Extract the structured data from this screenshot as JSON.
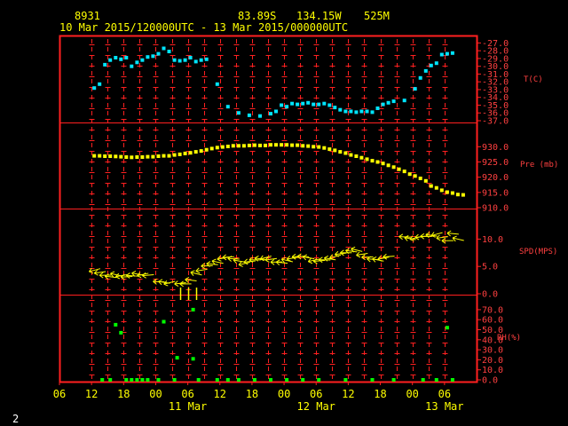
{
  "header": {
    "station_id": "8931",
    "lat": "83.89S",
    "lon": "134.15W",
    "elev": "525M",
    "time_range": "10 Mar 2015/120000UTC - 13 Mar 2015/000000UTC"
  },
  "page_number": "2",
  "colors": {
    "background": "#000000",
    "frame": "#ff2020",
    "panel_label": "#ff4040",
    "header_text": "#ffff00",
    "temperature": "#00e5ff",
    "pressure": "#ffff00",
    "wind": "#ffff00",
    "humidity": "#00ff00"
  },
  "chart_data": {
    "type": "scatter",
    "x_axis": {
      "unit": "hour",
      "range": [
        6,
        84
      ],
      "tick_labels": [
        "06",
        "12",
        "18",
        "00",
        "06",
        "12",
        "18",
        "00",
        "06",
        "12",
        "18",
        "00",
        "06"
      ],
      "day_labels": [
        {
          "label": "11 Mar",
          "hour": 30
        },
        {
          "label": "12 Mar",
          "hour": 54
        },
        {
          "label": "13 Mar",
          "hour": 78
        }
      ]
    },
    "panels": [
      {
        "key": "temperature",
        "label": "T(C)",
        "ylim": [
          -37,
          -26.5
        ],
        "ticks": [
          "-27.0",
          "-28.0",
          "-29.0",
          "-30.0",
          "-31.0",
          "-32.0",
          "-33.0",
          "-34.0",
          "-35.0",
          "-36.0",
          "-37.0"
        ],
        "tick_values": [
          -27,
          -28,
          -29,
          -30,
          -31,
          -32,
          -33,
          -34,
          -35,
          -36,
          -37
        ],
        "points": [
          [
            12.5,
            -32.8
          ],
          [
            13.5,
            -32.3
          ],
          [
            14.5,
            -29.8
          ],
          [
            15.5,
            -29.2
          ],
          [
            16.5,
            -28.9
          ],
          [
            17.5,
            -29.1
          ],
          [
            18.5,
            -28.9
          ],
          [
            19.5,
            -30.0
          ],
          [
            20.5,
            -29.5
          ],
          [
            21.5,
            -29.2
          ],
          [
            22.5,
            -28.8
          ],
          [
            23.5,
            -28.7
          ],
          [
            24.5,
            -28.4
          ],
          [
            25.5,
            -27.7
          ],
          [
            26.5,
            -28.1
          ],
          [
            27.5,
            -29.2
          ],
          [
            28.5,
            -29.3
          ],
          [
            29.5,
            -29.2
          ],
          [
            30.5,
            -28.9
          ],
          [
            31.5,
            -29.4
          ],
          [
            32.5,
            -29.2
          ],
          [
            33.5,
            -29.1
          ],
          [
            35.5,
            -32.3
          ],
          [
            37.5,
            -35.2
          ],
          [
            39.5,
            -36.0
          ],
          [
            41.5,
            -36.3
          ],
          [
            43.5,
            -36.4
          ],
          [
            45.5,
            -36.1
          ],
          [
            46.5,
            -35.8
          ],
          [
            47.5,
            -35.0
          ],
          [
            48.5,
            -35.2
          ],
          [
            49.5,
            -34.8
          ],
          [
            50.5,
            -34.9
          ],
          [
            51.5,
            -34.8
          ],
          [
            52.5,
            -34.7
          ],
          [
            53.5,
            -34.9
          ],
          [
            54.5,
            -34.9
          ],
          [
            55.5,
            -34.8
          ],
          [
            56.5,
            -35.0
          ],
          [
            57.5,
            -35.3
          ],
          [
            58.5,
            -35.6
          ],
          [
            59.5,
            -35.8
          ],
          [
            60.5,
            -35.8
          ],
          [
            61.5,
            -35.9
          ],
          [
            62.5,
            -35.8
          ],
          [
            63.5,
            -35.8
          ],
          [
            64.5,
            -35.9
          ],
          [
            65.5,
            -35.4
          ],
          [
            66.5,
            -34.9
          ],
          [
            67.5,
            -34.7
          ],
          [
            68.5,
            -34.5
          ],
          [
            70.5,
            -34.4
          ],
          [
            72.5,
            -32.9
          ],
          [
            73.5,
            -31.5
          ],
          [
            74.5,
            -30.6
          ],
          [
            75.5,
            -29.9
          ],
          [
            76.5,
            -29.6
          ],
          [
            77.5,
            -28.5
          ],
          [
            78.5,
            -28.4
          ],
          [
            79.5,
            -28.3
          ]
        ]
      },
      {
        "key": "pressure",
        "label": "Pre (mb)",
        "ylim": [
          910,
          933
        ],
        "ticks": [
          "930.0",
          "925.0",
          "920.0",
          "915.0",
          "910.0"
        ],
        "tick_values": [
          930,
          925,
          920,
          915,
          910
        ],
        "points": [
          [
            12.5,
            927.0
          ],
          [
            13.5,
            927.0
          ],
          [
            14.5,
            926.9
          ],
          [
            15.5,
            926.9
          ],
          [
            16.5,
            926.8
          ],
          [
            17.5,
            926.7
          ],
          [
            18.5,
            926.6
          ],
          [
            19.5,
            926.5
          ],
          [
            20.5,
            926.6
          ],
          [
            21.5,
            926.6
          ],
          [
            22.5,
            926.7
          ],
          [
            23.5,
            926.7
          ],
          [
            24.5,
            926.9
          ],
          [
            25.5,
            927.0
          ],
          [
            26.5,
            927.0
          ],
          [
            27.5,
            927.3
          ],
          [
            28.5,
            927.5
          ],
          [
            29.5,
            927.8
          ],
          [
            30.5,
            928.0
          ],
          [
            31.5,
            928.3
          ],
          [
            32.5,
            928.6
          ],
          [
            33.5,
            929.0
          ],
          [
            34.5,
            929.4
          ],
          [
            35.5,
            929.7
          ],
          [
            36.5,
            929.9
          ],
          [
            37.5,
            930.1
          ],
          [
            38.5,
            930.3
          ],
          [
            39.5,
            930.3
          ],
          [
            40.5,
            930.3
          ],
          [
            41.5,
            930.4
          ],
          [
            42.5,
            930.5
          ],
          [
            43.5,
            930.4
          ],
          [
            44.5,
            930.4
          ],
          [
            45.5,
            930.6
          ],
          [
            46.5,
            930.6
          ],
          [
            47.5,
            930.6
          ],
          [
            48.5,
            930.6
          ],
          [
            49.5,
            930.5
          ],
          [
            50.5,
            930.5
          ],
          [
            51.5,
            930.3
          ],
          [
            52.5,
            930.2
          ],
          [
            53.5,
            930.0
          ],
          [
            54.5,
            929.9
          ],
          [
            55.5,
            929.6
          ],
          [
            56.5,
            929.2
          ],
          [
            57.5,
            928.8
          ],
          [
            58.5,
            928.3
          ],
          [
            59.5,
            927.9
          ],
          [
            60.5,
            927.3
          ],
          [
            61.5,
            926.9
          ],
          [
            62.5,
            926.4
          ],
          [
            63.5,
            925.9
          ],
          [
            64.5,
            925.4
          ],
          [
            65.5,
            925.0
          ],
          [
            66.5,
            924.5
          ],
          [
            67.5,
            923.9
          ],
          [
            68.5,
            923.3
          ],
          [
            69.5,
            922.6
          ],
          [
            70.5,
            921.9
          ],
          [
            71.5,
            921.0
          ],
          [
            72.5,
            920.4
          ],
          [
            73.5,
            919.6
          ],
          [
            74.5,
            918.8
          ],
          [
            75.5,
            917.1
          ],
          [
            76.5,
            916.5
          ],
          [
            77.5,
            915.7
          ],
          [
            78.5,
            915.1
          ],
          [
            79.5,
            914.8
          ],
          [
            80.5,
            914.3
          ],
          [
            81.5,
            914.2
          ]
        ]
      },
      {
        "key": "wind",
        "label": "SPD(MPS)",
        "ylim": [
          0,
          12.5
        ],
        "ticks": [
          "10.0",
          "5.0",
          "0.0"
        ],
        "tick_values": [
          10,
          5,
          0
        ],
        "points": [
          [
            12.5,
            4.3
          ],
          [
            13.5,
            3.9
          ],
          [
            14.5,
            3.4
          ],
          [
            15.5,
            3.1
          ],
          [
            16.5,
            3.5
          ],
          [
            17.5,
            3.3
          ],
          [
            18.5,
            3.1
          ],
          [
            19.5,
            3.3
          ],
          [
            20.5,
            3.6
          ],
          [
            21.5,
            3.5
          ],
          [
            22.5,
            3.4
          ],
          [
            24.5,
            2.2
          ],
          [
            25.5,
            2.1
          ],
          [
            26.5,
            2.0
          ],
          [
            28.5,
            1.9
          ],
          [
            29.5,
            1.8
          ],
          [
            30.5,
            2.5
          ],
          [
            31.5,
            3.7
          ],
          [
            32.5,
            4.3
          ],
          [
            33.5,
            5.1
          ],
          [
            34.5,
            5.4
          ],
          [
            35.5,
            5.8
          ],
          [
            36.5,
            6.5
          ],
          [
            37.5,
            6.7
          ],
          [
            38.5,
            6.4
          ],
          [
            39.5,
            6.0
          ],
          [
            40.5,
            5.5
          ],
          [
            41.5,
            5.9
          ],
          [
            42.5,
            6.2
          ],
          [
            43.5,
            6.4
          ],
          [
            44.5,
            6.6
          ],
          [
            45.5,
            6.3
          ],
          [
            46.5,
            5.8
          ],
          [
            47.5,
            5.7
          ],
          [
            48.5,
            6.1
          ],
          [
            49.5,
            6.5
          ],
          [
            50.5,
            6.8
          ],
          [
            51.5,
            6.8
          ],
          [
            52.5,
            6.6
          ],
          [
            53.5,
            6.1
          ],
          [
            54.5,
            6.0
          ],
          [
            55.5,
            6.2
          ],
          [
            56.5,
            6.4
          ],
          [
            57.5,
            6.8
          ],
          [
            58.5,
            7.3
          ],
          [
            59.5,
            7.5
          ],
          [
            60.5,
            7.8
          ],
          [
            61.5,
            8.0
          ],
          [
            62.5,
            7.2
          ],
          [
            63.5,
            6.7
          ],
          [
            64.5,
            6.3
          ],
          [
            65.5,
            6.2
          ],
          [
            66.5,
            6.5
          ],
          [
            67.5,
            6.8
          ],
          [
            70.5,
            10.4
          ],
          [
            71.5,
            10.1
          ],
          [
            72.5,
            10.2
          ],
          [
            73.5,
            10.4
          ],
          [
            74.5,
            10.5
          ],
          [
            75.5,
            10.7
          ],
          [
            76.5,
            10.9
          ],
          [
            77.5,
            10.3
          ],
          [
            78.5,
            9.7
          ],
          [
            79.5,
            11.0
          ],
          [
            80.5,
            10.0
          ]
        ],
        "calm_hours": [
          28.5,
          30.0,
          31.5
        ]
      },
      {
        "key": "humidity",
        "label": "RH(%)",
        "ylim": [
          0,
          77
        ],
        "ticks": [
          "70.0",
          "60.0",
          "50.0",
          "40.0",
          "30.0",
          "20.0",
          "10.0",
          "0.0"
        ],
        "tick_values": [
          70,
          60,
          50,
          40,
          30,
          20,
          10,
          0
        ],
        "points": [
          [
            14.0,
            0
          ],
          [
            15.5,
            0
          ],
          [
            16.5,
            55
          ],
          [
            17.5,
            47
          ],
          [
            18.5,
            0
          ],
          [
            19.5,
            0
          ],
          [
            20.5,
            0
          ],
          [
            21.5,
            0
          ],
          [
            22.5,
            0
          ],
          [
            24.5,
            0
          ],
          [
            25.5,
            58
          ],
          [
            27.5,
            0
          ],
          [
            28.0,
            22
          ],
          [
            31.0,
            21
          ],
          [
            31.0,
            70
          ],
          [
            32.0,
            0
          ],
          [
            35.5,
            0
          ],
          [
            37.5,
            0
          ],
          [
            39.5,
            0
          ],
          [
            42.5,
            0
          ],
          [
            45.5,
            0
          ],
          [
            48.5,
            0
          ],
          [
            51.5,
            0
          ],
          [
            54.5,
            0
          ],
          [
            59.5,
            0
          ],
          [
            64.5,
            0
          ],
          [
            68.5,
            0
          ],
          [
            74.0,
            0
          ],
          [
            76.5,
            0
          ],
          [
            78.5,
            52
          ],
          [
            79.5,
            0
          ]
        ]
      }
    ]
  }
}
